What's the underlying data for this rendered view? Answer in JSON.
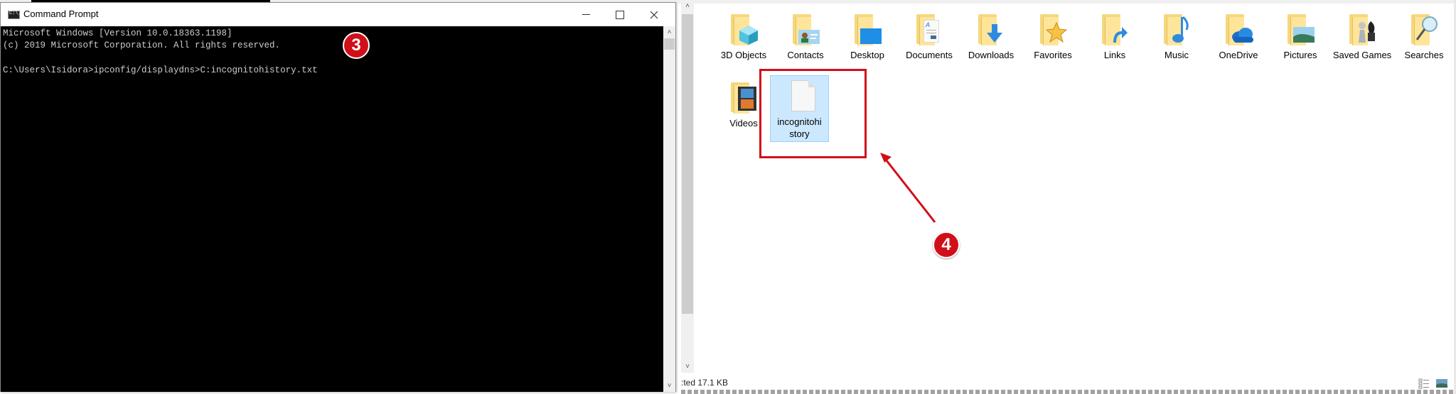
{
  "command_prompt": {
    "title": "Command Prompt",
    "lines": [
      "Microsoft Windows [Version 10.0.18363.1198]",
      "(c) 2019 Microsoft Corporation. All rights reserved.",
      "",
      "C:\\Users\\Isidora>ipconfig/displaydns>C:incognitohistory.txt"
    ],
    "icons": {
      "app": "cmd-icon",
      "minimize": "minimize-icon",
      "maximize": "maximize-icon",
      "close": "close-icon"
    }
  },
  "annotations": {
    "step3": "3",
    "step4": "4",
    "accent_color": "#d10f18"
  },
  "explorer": {
    "items": [
      {
        "label": "3D Objects",
        "icon": "3d-objects-folder-icon"
      },
      {
        "label": "Contacts",
        "icon": "contacts-folder-icon"
      },
      {
        "label": "Desktop",
        "icon": "desktop-folder-icon"
      },
      {
        "label": "Documents",
        "icon": "documents-folder-icon"
      },
      {
        "label": "Downloads",
        "icon": "downloads-folder-icon"
      },
      {
        "label": "Favorites",
        "icon": "favorites-folder-icon"
      },
      {
        "label": "Links",
        "icon": "links-folder-icon"
      },
      {
        "label": "Music",
        "icon": "music-folder-icon"
      },
      {
        "label": "OneDrive",
        "icon": "onedrive-folder-icon"
      },
      {
        "label": "Pictures",
        "icon": "pictures-folder-icon"
      },
      {
        "label": "Saved Games",
        "icon": "saved-games-folder-icon"
      },
      {
        "label": "Searches",
        "icon": "searches-folder-icon"
      },
      {
        "label": "Videos",
        "icon": "videos-folder-icon"
      },
      {
        "label": "incognitohistory",
        "icon": "text-file-icon",
        "selected": true
      }
    ],
    "status_text": ":ted  17.1 KB",
    "view_icons": [
      "details-view-icon",
      "large-icons-view-icon"
    ]
  }
}
